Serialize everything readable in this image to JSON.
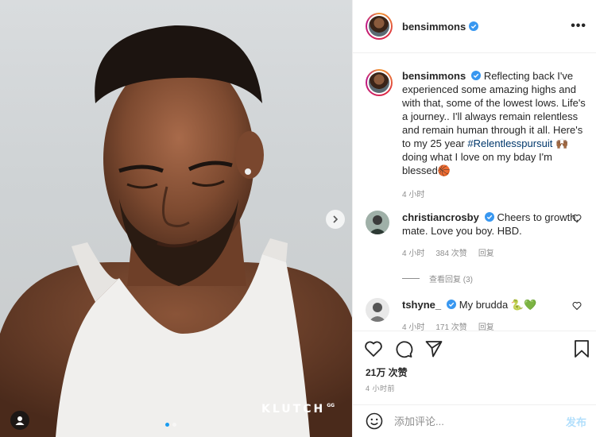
{
  "post": {
    "username": "bensimmons",
    "verified": true,
    "more_icon": "more-horizontal-icon",
    "watermark": "KLUTCH",
    "watermark_sub": "GG",
    "slide_count": 2,
    "active_slide": 1
  },
  "caption": {
    "username": "bensimmons",
    "text_before": "Reflecting back I've experienced some amazing highs and with that, some of the lowest lows. Life's a journey.. I'll always remain relentless and remain human through it all. Here's to my 25 year ",
    "hashtag": "#Relentlesspursuit",
    "text_mid": " 🙌🏾 doing what I love on my bday I'm blessed",
    "text_end": "🏀",
    "time": "4 小时"
  },
  "comments": [
    {
      "username": "christiancrosby",
      "verified": true,
      "text": "Cheers to growth, mate. Love you boy. HBD.",
      "time": "4 小时",
      "likes": "384 次赞",
      "reply_label": "回复"
    },
    {
      "username": "tshyne_",
      "verified": true,
      "text": "My brudda 🐍💚",
      "time": "4 小时",
      "likes": "171 次赞",
      "reply_label": "回复"
    }
  ],
  "view_replies": "查看回复 (3)",
  "actions": {
    "like_icon": "heart-icon",
    "comment_icon": "comment-icon",
    "share_icon": "send-icon",
    "save_icon": "bookmark-icon"
  },
  "likes_count": "21万 次赞",
  "posted_ago": "4 小时前",
  "add_comment": {
    "placeholder": "添加评论...",
    "post_label": "发布"
  },
  "colors": {
    "verified": "#3897f0",
    "hashtag": "#00376b",
    "post_disabled": "#b2dffc",
    "secondary_text": "#8e8e8e",
    "slide_dot_active": "#1a9cf0"
  }
}
